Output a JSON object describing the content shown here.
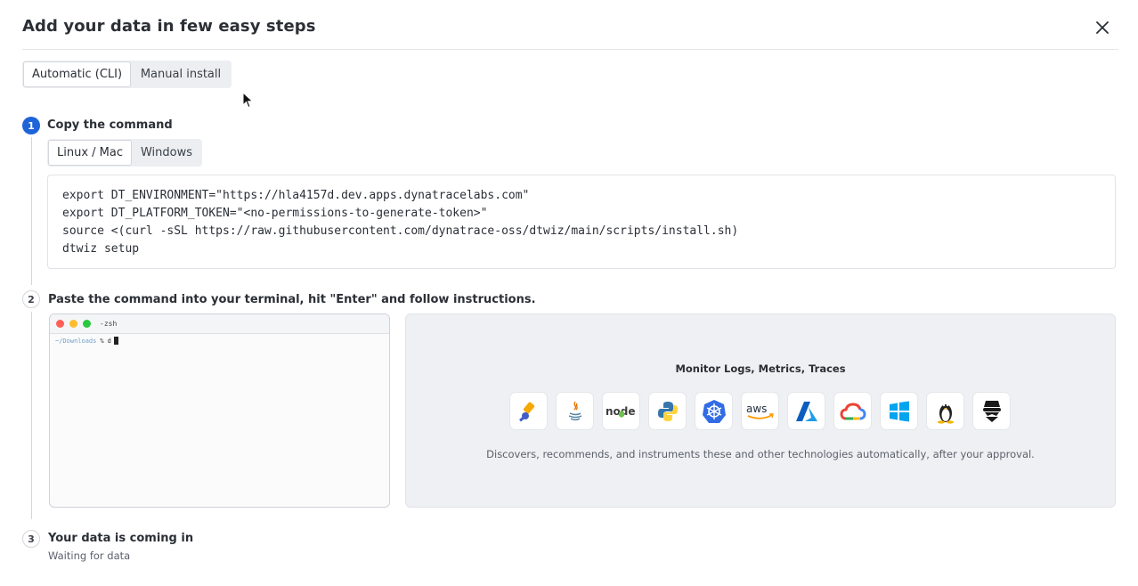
{
  "header": {
    "title": "Add your data in few easy steps"
  },
  "install_mode": {
    "options": [
      "Automatic (CLI)",
      "Manual install"
    ],
    "selected": "Automatic (CLI)"
  },
  "steps": [
    {
      "number": "1",
      "title": "Copy the command"
    },
    {
      "number": "2",
      "title": "Paste the command into your terminal, hit \"Enter\" and follow instructions."
    },
    {
      "number": "3",
      "title": "Your data is coming in",
      "subtitle": "Waiting for data"
    }
  ],
  "os_tabs": {
    "options": [
      "Linux / Mac",
      "Windows"
    ],
    "selected": "Linux / Mac"
  },
  "command": {
    "lines": [
      "export DT_ENVIRONMENT=\"https://hla4157d.dev.apps.dynatracelabs.com\"",
      "export DT_PLATFORM_TOKEN=\"<no-permissions-to-generate-token>\"",
      "source <(curl -sSL https://raw.githubusercontent.com/dynatrace-oss/dtwiz/main/scripts/install.sh)",
      "dtwiz setup"
    ]
  },
  "terminal": {
    "title": "-zsh",
    "prompt_path": "~/Downloads",
    "prompt_symbol": "%",
    "typed": "d"
  },
  "tech_panel": {
    "title": "Monitor Logs, Metrics, Traces",
    "description": "Discovers, recommends, and instruments these and other technologies automatically, after your approval.",
    "icons": [
      "opentelemetry-icon",
      "java-icon",
      "nodejs-icon",
      "python-icon",
      "kubernetes-icon",
      "aws-icon",
      "azure-icon",
      "google-cloud-icon",
      "windows-icon",
      "linux-icon",
      "anonymous-icon"
    ],
    "aws_label": "aws",
    "node_label": "node"
  },
  "colors": {
    "accent": "#1e63d8",
    "panel_bg": "#eff0f3"
  }
}
